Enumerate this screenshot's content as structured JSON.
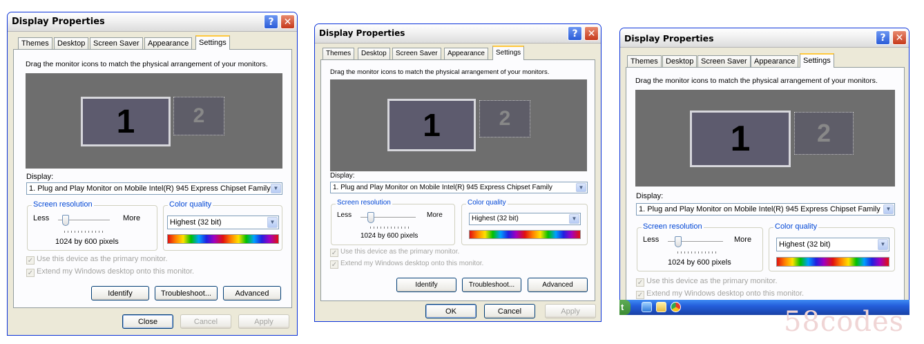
{
  "dialog": {
    "title": "Display Properties",
    "help_label": "?",
    "close_label": "✕",
    "tabs": [
      "Themes",
      "Desktop",
      "Screen Saver",
      "Appearance",
      "Settings"
    ],
    "instruction": "Drag the monitor icons to match the physical arrangement of your monitors.",
    "monitor1": "1",
    "monitor2": "2",
    "display_label": "Display:",
    "display_value": "1. Plug and Play Monitor on Mobile Intel(R) 945 Express Chipset Family",
    "resolution_group": "Screen resolution",
    "less_label": "Less",
    "more_label": "More",
    "resolution_value": "1024 by 600 pixels",
    "color_group": "Color quality",
    "color_value": "Highest (32 bit)",
    "use_primary": "Use this device as the primary monitor.",
    "extend_desktop": "Extend my Windows desktop onto this monitor.",
    "identify": "Identify",
    "troubleshoot": "Troubleshoot...",
    "advanced": "Advanced",
    "close_btn": "Close",
    "ok_btn": "OK",
    "cancel_btn": "Cancel",
    "apply_btn": "Apply"
  },
  "watermark": "58codes",
  "taskbar": {
    "start_glyph": "t"
  }
}
